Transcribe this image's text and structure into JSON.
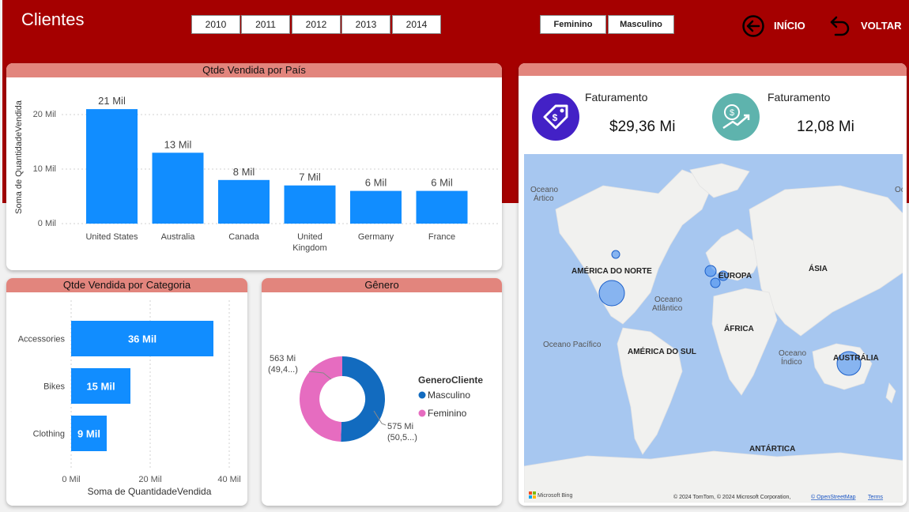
{
  "header": {
    "title": "Clientes",
    "years": [
      "2010",
      "2011",
      "2012",
      "2013",
      "2014"
    ],
    "genders": [
      "Feminino",
      "Masculino"
    ],
    "nav_home": "INÍCIO",
    "nav_back": "VOLTAR"
  },
  "country_chart": {
    "title": "Qtde Vendida por País",
    "ylabel": "Soma de QuantidadeVendida",
    "yticks": [
      "0 Mil",
      "10 Mil",
      "20 Mil"
    ]
  },
  "category_chart": {
    "title": "Qtde Vendida por Categoria",
    "xlabel": "Soma de QuantidadeVendida",
    "xticks": [
      "0 Mil",
      "20 Mil",
      "40 Mil"
    ]
  },
  "gender_chart": {
    "title": "Gênero",
    "legend_title": "GeneroCliente",
    "label_fem_1": "563 Mi",
    "label_fem_2": "(49,4...)",
    "label_masc_1": "575 Mi",
    "label_masc_2": "(50,5...)"
  },
  "kpis": [
    {
      "label": "Faturamento",
      "value": "$29,36 Mi"
    },
    {
      "label": "Faturamento",
      "value": "12,08 Mi"
    }
  ],
  "map": {
    "labels": [
      "Oceano",
      "Ártico",
      "AMÉRICA DO NORTE",
      "EUROPA",
      "ÁSIA",
      "Oceano",
      "Atlântico",
      "ÁFRICA",
      "Oceano Pacífico",
      "AMÉRICA DO SUL",
      "Oceano",
      "Índico",
      "AUSTRÁLIA",
      "ANTÁRTICA",
      "Oc"
    ],
    "bing": "Microsoft Bing",
    "copyright": "© 2024 TomTom, © 2024 Microsoft Corporation,",
    "osm": "© OpenStreetMap",
    "terms": "Terms"
  },
  "chart_data": [
    {
      "type": "bar",
      "title": "Qtde Vendida por País",
      "ylabel": "Soma de QuantidadeVendida",
      "categories": [
        "United States",
        "Australia",
        "Canada",
        "United Kingdom",
        "Germany",
        "France"
      ],
      "values": [
        21,
        13,
        8,
        7,
        6,
        6
      ],
      "data_labels": [
        "21 Mil",
        "13 Mil",
        "8 Mil",
        "7 Mil",
        "6 Mil",
        "6 Mil"
      ],
      "ylim": [
        0,
        23
      ],
      "color": "#118dff"
    },
    {
      "type": "bar",
      "orientation": "horizontal",
      "title": "Qtde Vendida por Categoria",
      "xlabel": "Soma de QuantidadeVendida",
      "categories": [
        "Accessories",
        "Bikes",
        "Clothing"
      ],
      "values": [
        36,
        15,
        9
      ],
      "data_labels": [
        "36 Mil",
        "15 Mil",
        "9 Mil"
      ],
      "xlim": [
        0,
        40
      ],
      "color": "#118dff"
    },
    {
      "type": "pie",
      "title": "Gênero",
      "legend_title": "GeneroCliente",
      "labels": [
        "Masculino",
        "Feminino"
      ],
      "values": [
        575,
        563
      ],
      "colors": [
        "#126bbf",
        "#e66cc0"
      ]
    }
  ]
}
